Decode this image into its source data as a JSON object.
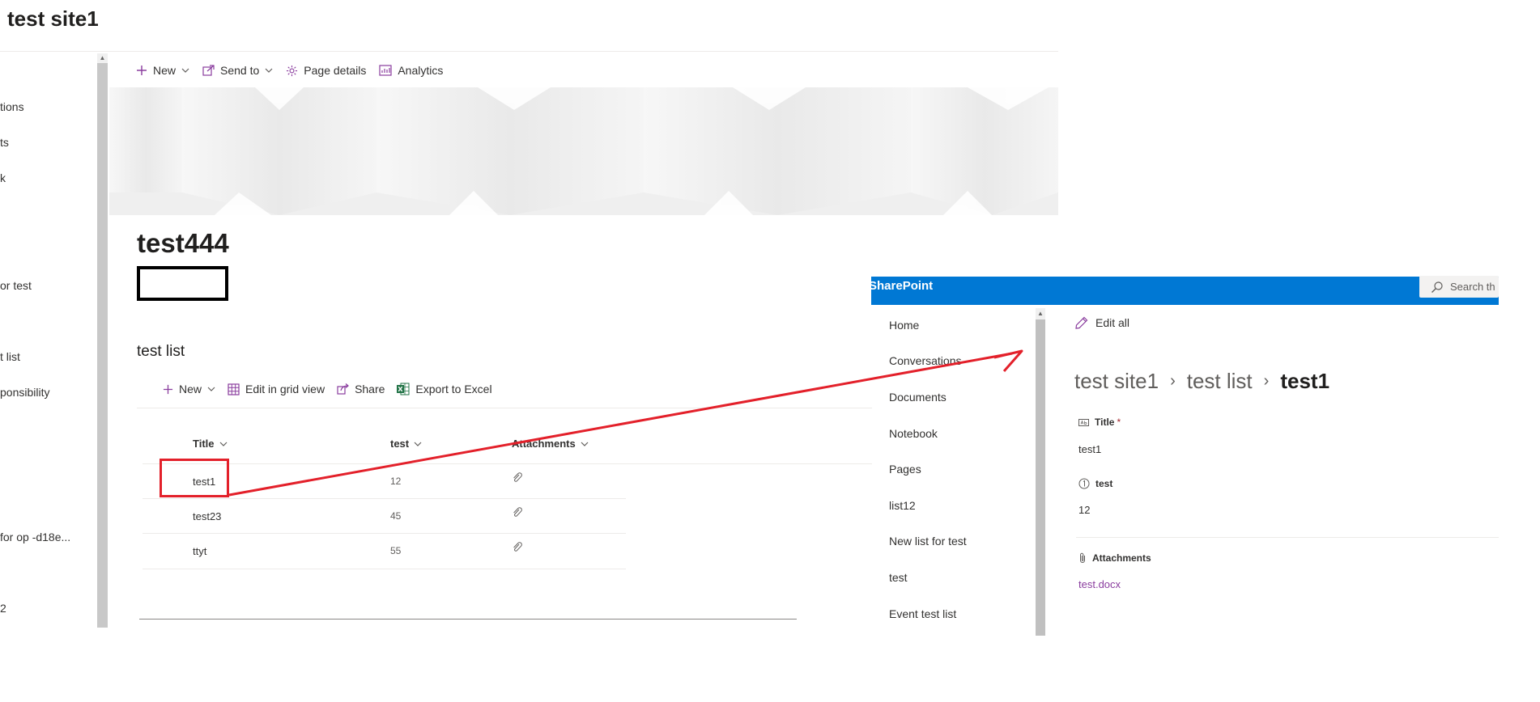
{
  "site": {
    "title": "test site1"
  },
  "left_nav": {
    "items": [
      "tions",
      "ts",
      "k",
      "or test",
      "t list",
      "ponsibility",
      "for op -d18e...",
      "2"
    ]
  },
  "page_cmdbar": {
    "new_label": "New",
    "send_to_label": "Send to",
    "page_details_label": "Page details",
    "analytics_label": "Analytics"
  },
  "page": {
    "title": "test444"
  },
  "list": {
    "heading": "test list",
    "cmdbar": {
      "new_label": "New",
      "edit_grid_label": "Edit in grid view",
      "share_label": "Share",
      "export_label": "Export to Excel"
    },
    "columns": [
      "Title",
      "test",
      "Attachments"
    ],
    "rows": [
      {
        "title": "test1",
        "test": "12"
      },
      {
        "title": "test23",
        "test": "45"
      },
      {
        "title": "ttyt",
        "test": "55"
      }
    ]
  },
  "sp_window": {
    "brand": "SharePoint",
    "search_placeholder": "Search th",
    "nav": [
      "Home",
      "Conversations",
      "Documents",
      "Notebook",
      "Pages",
      "list12",
      "New list for test",
      "test",
      "Event test list"
    ],
    "edit_all_label": "Edit all",
    "breadcrumb": [
      "test site1",
      "test list",
      "test1"
    ],
    "fields": {
      "title_label": "Title",
      "required_mark": "*",
      "title_value": "test1",
      "test_label": "test",
      "test_value": "12",
      "attachments_label": "Attachments",
      "attachment_file": "test.docx"
    }
  },
  "colors": {
    "accent_purple": "#8a3d9e",
    "sharepoint_blue": "#0078d4",
    "annotation_red": "#e3202a",
    "excel_green": "#217346"
  },
  "icons": [
    "plus-icon",
    "chevron-down-icon",
    "send-icon",
    "gear-icon",
    "analytics-icon",
    "grid-icon",
    "share-icon",
    "excel-icon",
    "paperclip-icon",
    "pencil-icon",
    "search-icon",
    "text-field-icon",
    "number-field-icon"
  ]
}
